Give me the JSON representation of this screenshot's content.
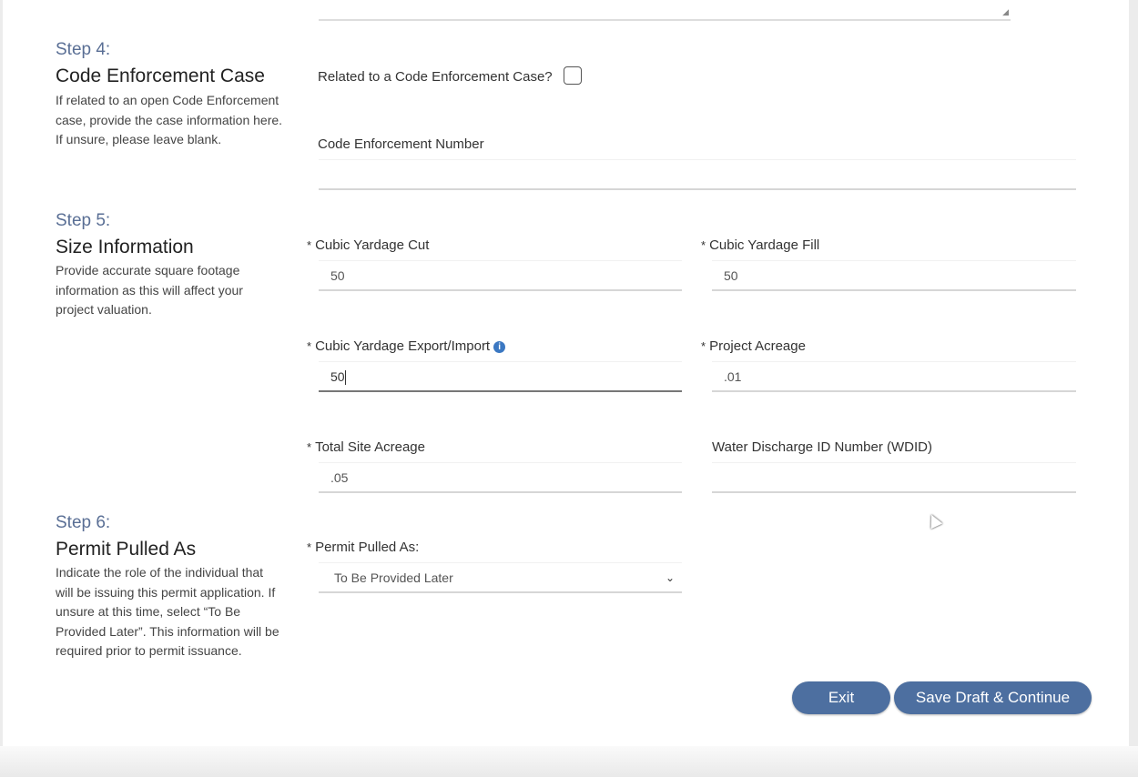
{
  "step4": {
    "step": "Step 4:",
    "title": "Code Enforcement Case",
    "description": "If related to an open Code Enforcement case, provide the case information here. If unsure, please leave blank.",
    "related_label": "Related to a Code Enforcement Case?",
    "related_checked": false,
    "number_label": "Code Enforcement Number",
    "number_value": ""
  },
  "step5": {
    "step": "Step 5:",
    "title": "Size Information",
    "description": "Provide accurate square footage information as this will affect your project valuation.",
    "required_mark": "*",
    "cut_label": "Cubic Yardage Cut",
    "cut_value": "50",
    "fill_label": "Cubic Yardage Fill",
    "fill_value": "50",
    "export_label": "Cubic Yardage Export/Import",
    "export_value": "50",
    "info_icon": "i",
    "project_acreage_label": "Project Acreage",
    "project_acreage_value": ".01",
    "total_acreage_label": "Total Site Acreage",
    "total_acreage_value": ".05",
    "wdid_label": "Water Discharge ID Number (WDID)",
    "wdid_value": ""
  },
  "step6": {
    "step": "Step 6:",
    "title": "Permit Pulled As",
    "description": "Indicate the role of the individual that will be issuing this permit application. If unsure at this time, select “To Be Provided Later”. This information will be required prior to permit issuance.",
    "required_mark": "*",
    "select_label": "Permit Pulled As:",
    "select_value": "To Be Provided Later"
  },
  "buttons": {
    "exit": "Exit",
    "save": "Save Draft & Continue"
  },
  "colors": {
    "step": "#5a6f95",
    "button": "#4d6fa0",
    "info": "#3b78c2"
  }
}
